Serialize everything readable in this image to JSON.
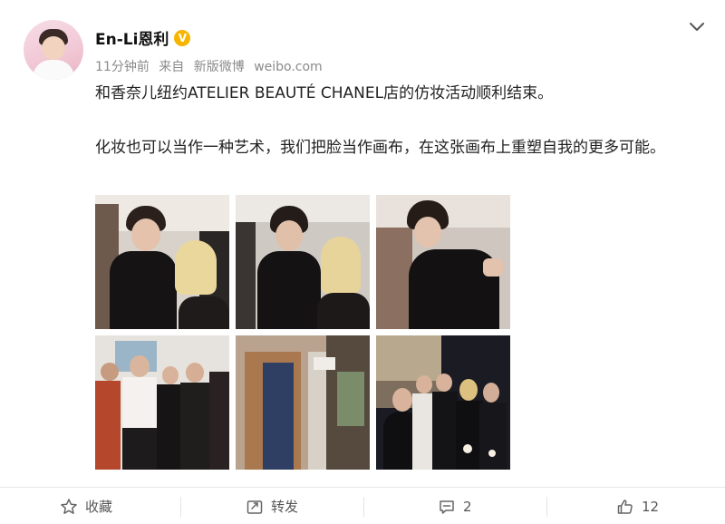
{
  "post": {
    "author": "En-Li恩利",
    "verified_badge": "V",
    "time": "11分钟前",
    "source_prefix": "来自",
    "source_name": "新版微博",
    "source_domain": "weibo.com",
    "text_line1": "和香奈儿纽约ATELIER BEAUTÉ CHANEL店的仿妆活动顺利结束。",
    "text_line2": "化妆也可以当作一种艺术，我们把脸当作画布，在这张画布上重塑自我的更多可能。",
    "photo_count": 6
  },
  "actions": {
    "favorite_label": "收藏",
    "repost_label": "转发",
    "comment_count": "2",
    "like_count": "12"
  },
  "icons": [
    "avatar",
    "verified-badge-icon",
    "chevron-down-icon",
    "star-icon",
    "repost-icon",
    "comment-icon",
    "thumbs-up-icon"
  ],
  "colors": {
    "accent_gold": "#f7b500",
    "text_gray": "#8a8a8a",
    "divider": "#e8e8e8"
  }
}
